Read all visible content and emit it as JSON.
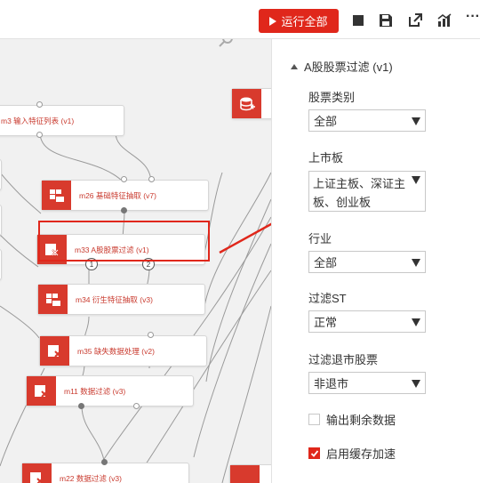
{
  "toolbar": {
    "run_all_label": "运行全部",
    "icons": [
      "stop-icon",
      "save-icon",
      "share-icon",
      "chart-icon",
      "more-icon"
    ],
    "more_label": "···"
  },
  "colors": {
    "accent": "#e0271b",
    "node_label": "#c93a2e",
    "canvas_bg": "#f1f1f1"
  },
  "canvas": {
    "nodes": [
      {
        "id": "m3",
        "label": "m3 输入特征列表 (v1)"
      },
      {
        "id": "m26",
        "label": "m26 基础特征抽取 (v7)"
      },
      {
        "id": "m33",
        "label": "m33 A股股票过滤 (v1)"
      },
      {
        "id": "m34",
        "label": "m34 衍生特征抽取 (v3)"
      },
      {
        "id": "m35",
        "label": "m35 缺失数据处理 (v2)"
      },
      {
        "id": "m11",
        "label": "m11 数据过滤 (v3)"
      },
      {
        "id": "m22",
        "label": "m22 数据过滤 (v3)"
      }
    ],
    "ports": [
      "1",
      "2"
    ]
  },
  "panel": {
    "title": "A股股票过滤 (v1)",
    "fields": {
      "stock_type": {
        "label": "股票类别",
        "value": "全部"
      },
      "market_board": {
        "label": "上市板",
        "value": "上证主板、深证主板、创业板"
      },
      "industry": {
        "label": "行业",
        "value": "全部"
      },
      "filter_st": {
        "label": "过滤ST",
        "value": "正常"
      },
      "filter_delisted": {
        "label": "过滤退市股票",
        "value": "非退市"
      }
    },
    "checkboxes": {
      "output_remaining": {
        "label": "输出剩余数据",
        "checked": false
      },
      "enable_cache": {
        "label": "启用缓存加速",
        "checked": true
      }
    }
  }
}
